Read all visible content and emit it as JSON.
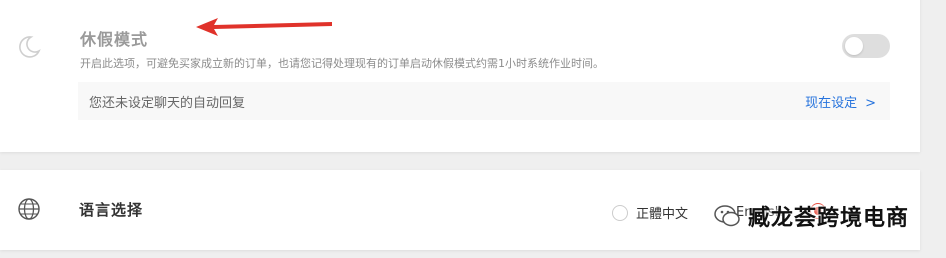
{
  "vacation": {
    "title": "休假模式",
    "description": "开启此选项，可避免买家成立新的订单，也请您记得处理现有的订单启动休假模式约需1小时系统作业时间。",
    "toggle_on": false,
    "autoreply_text": "您还未设定聊天的自动回复",
    "setup_link": "现在设定",
    "accent_color": "#e0322a"
  },
  "language": {
    "title": "语言选择",
    "options": [
      "正體中文",
      "English"
    ]
  },
  "watermark": {
    "text": "臧龙荟跨境电商"
  },
  "icons": [
    "moon-icon",
    "chevron-right-icon",
    "globe-icon",
    "arrow-annotation-icon",
    "wechat-logo-icon"
  ]
}
